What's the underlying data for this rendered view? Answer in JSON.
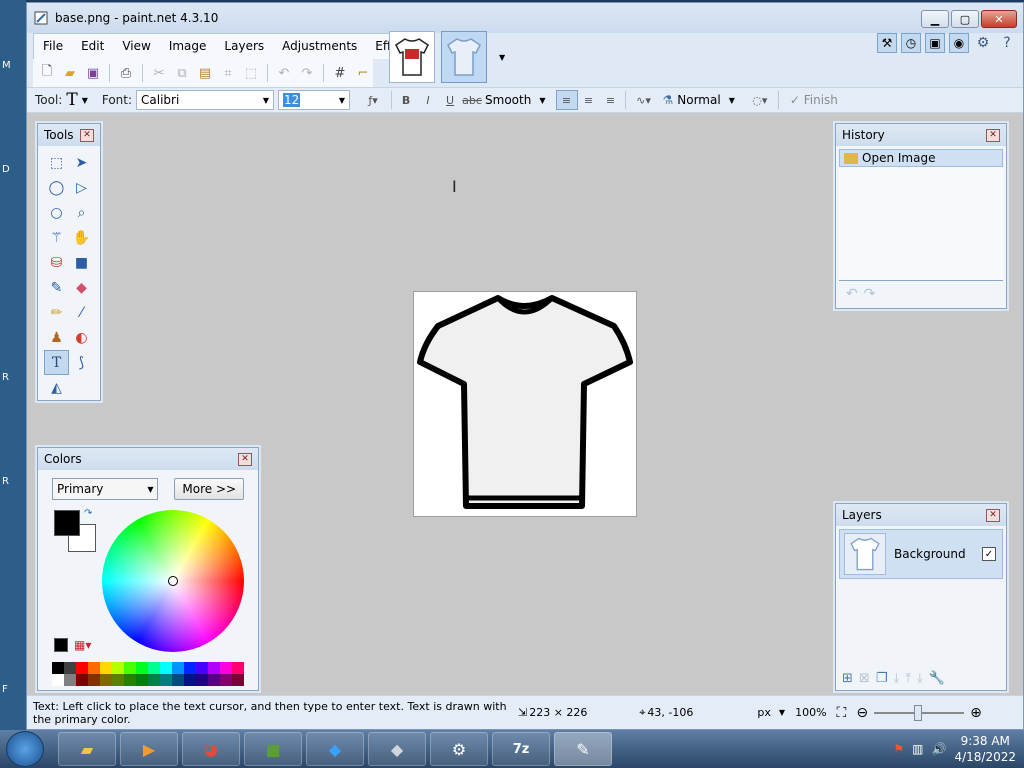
{
  "window": {
    "title": "base.png - paint.net 4.3.10"
  },
  "desktop_labels": [
    "M",
    "D",
    "R",
    "R",
    "F"
  ],
  "menu": [
    "File",
    "Edit",
    "View",
    "Image",
    "Layers",
    "Adjustments",
    "Effects"
  ],
  "texttoolbar": {
    "tool_label": "Tool:",
    "font_label": "Font:",
    "font_value": "Calibri",
    "size_value": "12",
    "bold": "B",
    "italic": "I",
    "underline": "U",
    "strike": "abc",
    "antialias": "Smooth",
    "blend": "Normal",
    "finish": "Finish"
  },
  "tools_panel": {
    "title": "Tools",
    "tools": [
      "rectangle-select",
      "move-selected",
      "lasso-select",
      "move-selection",
      "ellipse-select",
      "zoom",
      "magic-wand",
      "pan",
      "paint-bucket",
      "gradient",
      "paintbrush",
      "eraser",
      "pencil",
      "color-picker",
      "clone-stamp",
      "recolor",
      "text",
      "line-curve",
      "shapes"
    ]
  },
  "history_panel": {
    "title": "History",
    "items": [
      "Open Image"
    ]
  },
  "layers_panel": {
    "title": "Layers",
    "layers": [
      {
        "name": "Background",
        "visible": true
      }
    ]
  },
  "colors_panel": {
    "title": "Colors",
    "mode": "Primary",
    "more_button": "More >>",
    "primary_color": "#000000",
    "secondary_color": "#ffffff",
    "palette": [
      "#000000",
      "#404040",
      "#ff0000",
      "#ff6a00",
      "#ffd800",
      "#b6ff00",
      "#4cff00",
      "#00ff21",
      "#00ff90",
      "#00ffff",
      "#0094ff",
      "#0026ff",
      "#4800ff",
      "#b200ff",
      "#ff00dc",
      "#ff006e",
      "#ffffff",
      "#808080",
      "#7f0000",
      "#7f3300",
      "#7f6a00",
      "#5b7f00",
      "#267f00",
      "#007f0e",
      "#007f46",
      "#007f7f",
      "#004a7f",
      "#00137f",
      "#21007f",
      "#57007f",
      "#7f006e",
      "#7f0037"
    ]
  },
  "status": {
    "message": "Text: Left click to place the text cursor, and then type to enter text. Text is drawn with the primary color.",
    "image_size": "223 × 226",
    "cursor_pos": "43, -106",
    "units": "px",
    "zoom": "100%"
  },
  "taskbar": {
    "apps": [
      "explorer",
      "media-player",
      "chrome",
      "minecraft",
      "roblox",
      "roblox-studio",
      "steam",
      "7-zip",
      "paint.net"
    ],
    "time": "9:38 AM",
    "date": "4/18/2022"
  }
}
